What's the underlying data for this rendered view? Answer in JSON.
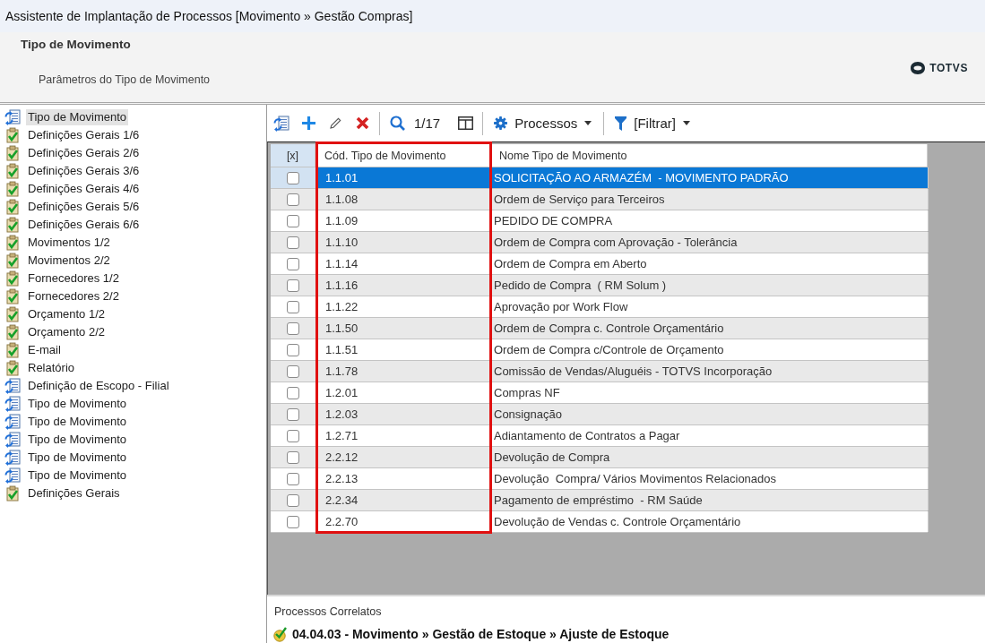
{
  "window": {
    "title": "Assistente de Implantação de Processos [Movimento » Gestão Compras]"
  },
  "header": {
    "title": "Tipo de Movimento",
    "subtitle": "Parâmetros do Tipo de Movimento",
    "logo": "TOTVS"
  },
  "steps": [
    {
      "label": "Tipo de Movimento",
      "kind": "process",
      "selected": true
    },
    {
      "label": "Definições Gerais 1/6",
      "kind": "done",
      "selected": false
    },
    {
      "label": "Definições Gerais 2/6",
      "kind": "done",
      "selected": false
    },
    {
      "label": "Definições Gerais 3/6",
      "kind": "done",
      "selected": false
    },
    {
      "label": "Definições Gerais 4/6",
      "kind": "done",
      "selected": false
    },
    {
      "label": "Definições Gerais 5/6",
      "kind": "done",
      "selected": false
    },
    {
      "label": "Definições Gerais 6/6",
      "kind": "done",
      "selected": false
    },
    {
      "label": "Movimentos 1/2",
      "kind": "done",
      "selected": false
    },
    {
      "label": "Movimentos 2/2",
      "kind": "done",
      "selected": false
    },
    {
      "label": "Fornecedores 1/2",
      "kind": "done",
      "selected": false
    },
    {
      "label": "Fornecedores 2/2",
      "kind": "done",
      "selected": false
    },
    {
      "label": "Orçamento 1/2",
      "kind": "done",
      "selected": false
    },
    {
      "label": "Orçamento 2/2",
      "kind": "done",
      "selected": false
    },
    {
      "label": "E-mail",
      "kind": "done",
      "selected": false
    },
    {
      "label": "Relatório",
      "kind": "done",
      "selected": false
    },
    {
      "label": "Definição de Escopo - Filial",
      "kind": "process",
      "selected": false
    },
    {
      "label": "Tipo de Movimento",
      "kind": "process",
      "selected": false
    },
    {
      "label": "Tipo de Movimento",
      "kind": "process",
      "selected": false
    },
    {
      "label": "Tipo de Movimento",
      "kind": "process",
      "selected": false
    },
    {
      "label": "Tipo de Movimento",
      "kind": "process",
      "selected": false
    },
    {
      "label": "Tipo de Movimento",
      "kind": "process",
      "selected": false
    },
    {
      "label": "Definições Gerais",
      "kind": "done",
      "selected": false
    }
  ],
  "toolbar": {
    "counter": "1/17",
    "menus": [
      {
        "label": "Processos",
        "kind": "gear"
      },
      {
        "label": "[Filtrar]",
        "kind": "filter"
      }
    ]
  },
  "table": {
    "columns": [
      {
        "label": "[x]",
        "highlighted": false
      },
      {
        "label": "Cód. Tipo de Movimento",
        "highlighted": true
      },
      {
        "label": "Nome Tipo de Movimento",
        "highlighted": false
      }
    ],
    "rows": [
      {
        "code": "1.1.01",
        "name": "SOLICITAÇÃO AO ARMAZÉM  - MOVIMENTO PADRÃO",
        "checked": false,
        "selected": true
      },
      {
        "code": "1.1.08",
        "name": "Ordem de Serviço para Terceiros",
        "checked": false,
        "selected": false
      },
      {
        "code": "1.1.09",
        "name": "PEDIDO DE COMPRA",
        "checked": false,
        "selected": false
      },
      {
        "code": "1.1.10",
        "name": "Ordem de Compra com Aprovação - Tolerância",
        "checked": false,
        "selected": false
      },
      {
        "code": "1.1.14",
        "name": "Ordem de Compra em Aberto",
        "checked": false,
        "selected": false
      },
      {
        "code": "1.1.16",
        "name": "Pedido de Compra  ( RM Solum )",
        "checked": false,
        "selected": false
      },
      {
        "code": "1.1.22",
        "name": "Aprovação por Work Flow",
        "checked": false,
        "selected": false
      },
      {
        "code": "1.1.50",
        "name": "Ordem de Compra c. Controle Orçamentário",
        "checked": false,
        "selected": false
      },
      {
        "code": "1.1.51",
        "name": "Ordem de Compra c/Controle de Orçamento",
        "checked": false,
        "selected": false
      },
      {
        "code": "1.1.78",
        "name": "Comissão de Vendas/Aluguéis - TOTVS Incorporação",
        "checked": false,
        "selected": false
      },
      {
        "code": "1.2.01",
        "name": "Compras NF",
        "checked": false,
        "selected": false
      },
      {
        "code": "1.2.03",
        "name": "Consignação",
        "checked": false,
        "selected": false
      },
      {
        "code": "1.2.71",
        "name": "Adiantamento de Contratos a Pagar",
        "checked": false,
        "selected": false
      },
      {
        "code": "2.2.12",
        "name": "Devolução de Compra",
        "checked": false,
        "selected": false
      },
      {
        "code": "2.2.13",
        "name": "Devolução  Compra/ Vários Movimentos Relacionados",
        "checked": false,
        "selected": false
      },
      {
        "code": "2.2.34",
        "name": "Pagamento de empréstimo  - RM Saúde",
        "checked": false,
        "selected": false
      },
      {
        "code": "2.2.70",
        "name": "Devolução de Vendas c. Controle Orçamentário",
        "checked": false,
        "selected": false
      }
    ]
  },
  "related": {
    "title": "Processos Correlatos",
    "items": [
      "04.04.03 - Movimento » Gestão de Estoque » Ajuste de Estoque"
    ]
  }
}
